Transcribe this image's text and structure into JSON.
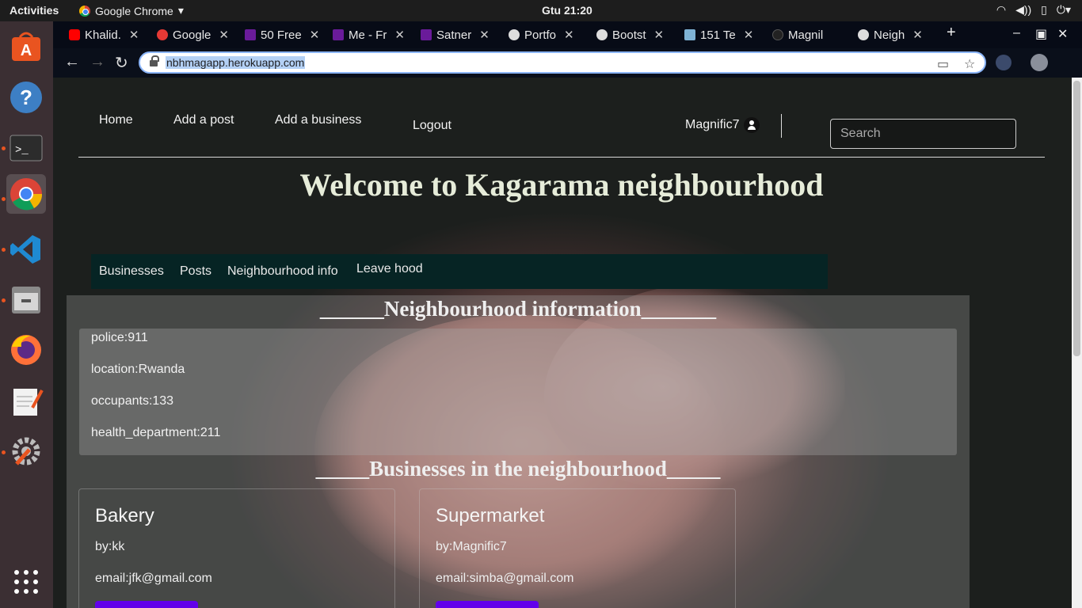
{
  "system": {
    "activities": "Activities",
    "app_name": "Google Chrome",
    "clock": "Gtu 21:20"
  },
  "browser": {
    "tabs": [
      {
        "label": "Khalid.",
        "icon": "youtube-icon"
      },
      {
        "label": "Google",
        "icon": "google-icon"
      },
      {
        "label": "50 Free",
        "icon": "colorlib-icon"
      },
      {
        "label": "Me - Fr",
        "icon": "colorlib-icon"
      },
      {
        "label": "Satner",
        "icon": "colorlib-icon"
      },
      {
        "label": "Portfo",
        "icon": "globe-icon"
      },
      {
        "label": "Bootst",
        "icon": "globe-icon"
      },
      {
        "label": "151 Te",
        "icon": "image-icon"
      },
      {
        "label": "Magnil",
        "icon": "github-icon"
      },
      {
        "label": "Neigh",
        "icon": "globe-icon"
      }
    ],
    "url": "nbhmagapp.herokuapp.com"
  },
  "nav": {
    "home": "Home",
    "add_post": "Add a post",
    "add_business": "Add a business",
    "logout": "Logout",
    "username": "Magnific7",
    "search_placeholder": "Search"
  },
  "welcome_title": "Welcome to Kagarama neighbourhood",
  "subnav": {
    "businesses": "Businesses",
    "posts": "Posts",
    "info": "Neighbourhood info",
    "leave": "Leave hood"
  },
  "info_section": {
    "title": "______Neighbourhood information_______",
    "items": [
      "police:911",
      "location:Rwanda",
      "occupants:133",
      "health_department:211"
    ]
  },
  "business_section": {
    "title": "_____Businesses in the neighbourhood_____",
    "cards": [
      {
        "name": "Bakery",
        "by": "by:kk",
        "email": "email:jfk@gmail.com"
      },
      {
        "name": "Supermarket",
        "by": "by:Magnific7",
        "email": "email:simba@gmail.com"
      }
    ]
  },
  "colors": {
    "subnav_bg": "#062424",
    "button": "#6200ea",
    "dock_bg": "#3b2f33"
  }
}
